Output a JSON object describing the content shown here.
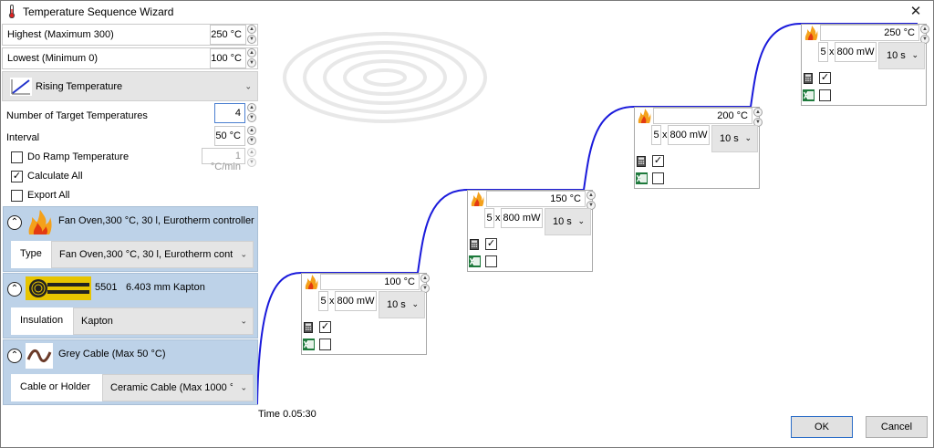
{
  "window": {
    "title": "Temperature Sequence Wizard",
    "close_glyph": "✕"
  },
  "fields": {
    "highest_label": "Highest (Maximum 300)",
    "highest_value": "250 °C",
    "lowest_label": "Lowest (Minimum 0)",
    "lowest_value": "100 °C",
    "mode_value": "Rising Temperature",
    "num_targets_label": "Number of Target Temperatures",
    "num_targets_value": "4",
    "interval_label": "Interval",
    "interval_value": "50 °C",
    "ramp_label": "Do Ramp Temperature",
    "ramp_value": "1 °C/min",
    "ramp_checked": false,
    "calc_all_label": "Calculate All",
    "calc_all_checked": true,
    "export_all_label": "Export All",
    "export_all_checked": false
  },
  "sections": {
    "oven": {
      "title": "Fan Oven,300 °C, 30 l, Eurotherm controller",
      "sub_label": "Type",
      "sub_value": "Fan Oven,300 °C, 30 l, Eurotherm cont"
    },
    "sensor": {
      "title_a": "5501",
      "title_b": "6.403 mm Kapton",
      "sub_label": "Insulation",
      "sub_value": "Kapton"
    },
    "cable": {
      "title": "Grey Cable (Max 50 °C)",
      "sub_label": "Cable or Holder",
      "sub_value": "Ceramic Cable (Max 1000 °"
    }
  },
  "steps": [
    {
      "temperature": "100 °C",
      "count": "5",
      "power": "800 mW",
      "time": "10 s",
      "calculate": true,
      "export": false
    },
    {
      "temperature": "150 °C",
      "count": "5",
      "power": "800 mW",
      "time": "10 s",
      "calculate": true,
      "export": false
    },
    {
      "temperature": "200 °C",
      "count": "5",
      "power": "800 mW",
      "time": "10 s",
      "calculate": true,
      "export": false
    },
    {
      "temperature": "250 °C",
      "count": "5",
      "power": "800 mW",
      "time": "10 s",
      "calculate": true,
      "export": false
    }
  ],
  "chart": {
    "time_label": "Time 0.05:30",
    "line_color": "#1a1adb"
  },
  "x_glyph": "x",
  "buttons": {
    "ok": "OK",
    "cancel": "Cancel"
  },
  "icons": [
    "thermometer-icon",
    "close-icon",
    "rising-temperature-icon",
    "flame-icon",
    "sensor-icon",
    "cable-icon",
    "calculator-icon",
    "excel-icon",
    "chevron-down-icon",
    "collapse-icon"
  ]
}
